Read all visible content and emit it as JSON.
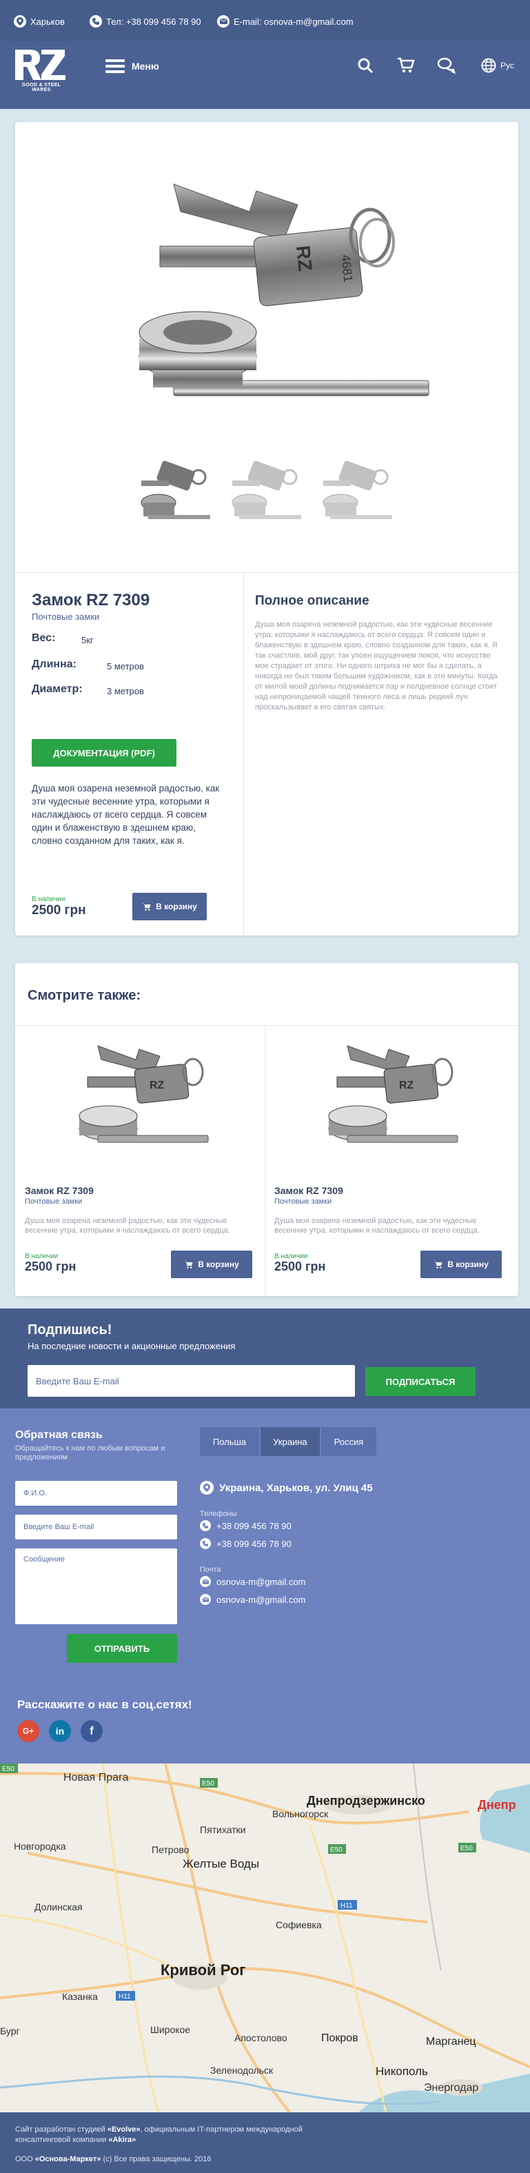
{
  "topbar": {
    "city": "Харьков",
    "phone": "Тел: +38 099 456 78 90",
    "email": "E-mail: osnova-m@gmail.com"
  },
  "nav": {
    "menu": "Меню",
    "lang": "Рус",
    "logo_tagline": "GOOD & STEEL WARES"
  },
  "product": {
    "title": "Замок RZ 7309",
    "category": "Почтовые замки",
    "specs": [
      {
        "label": "Вес:",
        "value": "5кг"
      },
      {
        "label": "Длинна:",
        "value": "5 метров"
      },
      {
        "label": "Диаметр:",
        "value": "3 метров"
      }
    ],
    "doc_button": "ДОКУМЕНТАЦИЯ (PDF)",
    "short_description": "Душа моя озарена неземной радостью, как эти чудесные весенние утра, которыми я наслаждаюсь от всего сердца. Я совсем один и блаженствую в здешнем краю, словно созданном для таких, как я.",
    "availability": "В наличии",
    "price": "2500 грн",
    "cart_button": "В корзину",
    "full_description_title": "Полное описание",
    "full_description": "Душа моя озарена неземной радостью, как эти чудесные весенние утра, которыми я наслаждаюсь от всего сердца. Я совсем один и блаженствую в здешнем краю, словно созданном для таких, как я. Я так счастлив, мой друг, так упоен ощущением покоя, что искусство мое страдает от этого. Ни одного штриха не мог бы я сделать, а никогда не был таким большим художником, как в эти минуты. Когда от милой моей долины поднимается пар и полдневное солнце стоит над непроницаемой чащей темного леса и лишь редкий луч проскальзывает в его святая святых."
  },
  "related": {
    "title": "Смотрите также:",
    "items": [
      {
        "title": "Замок RZ 7309",
        "category": "Почтовые замки",
        "description": "Душа моя озарена неземной радостью, как эти чудесные весенние утра, которыми я наслаждаюсь от всего сердца.",
        "availability": "В наличии",
        "price": "2500 грн",
        "cart_button": "В корзину"
      },
      {
        "title": "Замок RZ 7309",
        "category": "Почтовые замки",
        "description": "Душа моя озарена неземной радостью, как эти чудесные весенние утра, которыми я наслаждаюсь от всего сердца.",
        "availability": "В наличии",
        "price": "2500 грн",
        "cart_button": "В корзину"
      }
    ]
  },
  "subscribe": {
    "title": "Подпишись!",
    "subtitle": "На последние новости и акционные предложения",
    "placeholder": "Введите Ваш E-mail",
    "button": "ПОДПИСАТЬСЯ"
  },
  "contact": {
    "title": "Обратная связь",
    "subtitle": "Обращайтесь к нам по любым вопросам и предложениям",
    "name_placeholder": "Ф.И.О.",
    "email_placeholder": "Введите Ваш E-mail",
    "message_placeholder": "Сообщение",
    "send_button": "ОТПРАВИТЬ",
    "tabs": [
      "Польша",
      "Украина",
      "Россия"
    ],
    "address": "Украина, Харьков, ул. Улиц 45",
    "phones_label": "Телефоны",
    "phones": [
      "+38 099 456 78 90",
      "+38 099 456 78 90"
    ],
    "mail_label": "Почта",
    "emails": [
      "osnova-m@gmail.com",
      "osnova-m@gmail.com"
    ],
    "social_title": "Расскажите о нас в соц.сетях!"
  },
  "map": {
    "labels": [
      "Новая Прага",
      "Днепродзержинско",
      "Днепр",
      "Вольногорск",
      "Пятихатки",
      "Новгородка",
      "Петрово",
      "Желтые Воды",
      "Долинская",
      "Софиевка",
      "Кривой Рог",
      "Казанка",
      "Бург",
      "Широкое",
      "Апостолово",
      "Покров",
      "Марганец",
      "Зеленодольск",
      "Никополь",
      "Энергодар"
    ]
  },
  "footer": {
    "credits_pre": "Сайт разработан студией ",
    "studio": "«Evolve»",
    "credits_mid": ", официальным IT-партнером международной консалтинговой компании ",
    "company": "«Akira»",
    "copy_pre": "ООО ",
    "brand": "«Основа-Маркет»",
    "copy_post": " (c) Все права защищены. 2016"
  }
}
